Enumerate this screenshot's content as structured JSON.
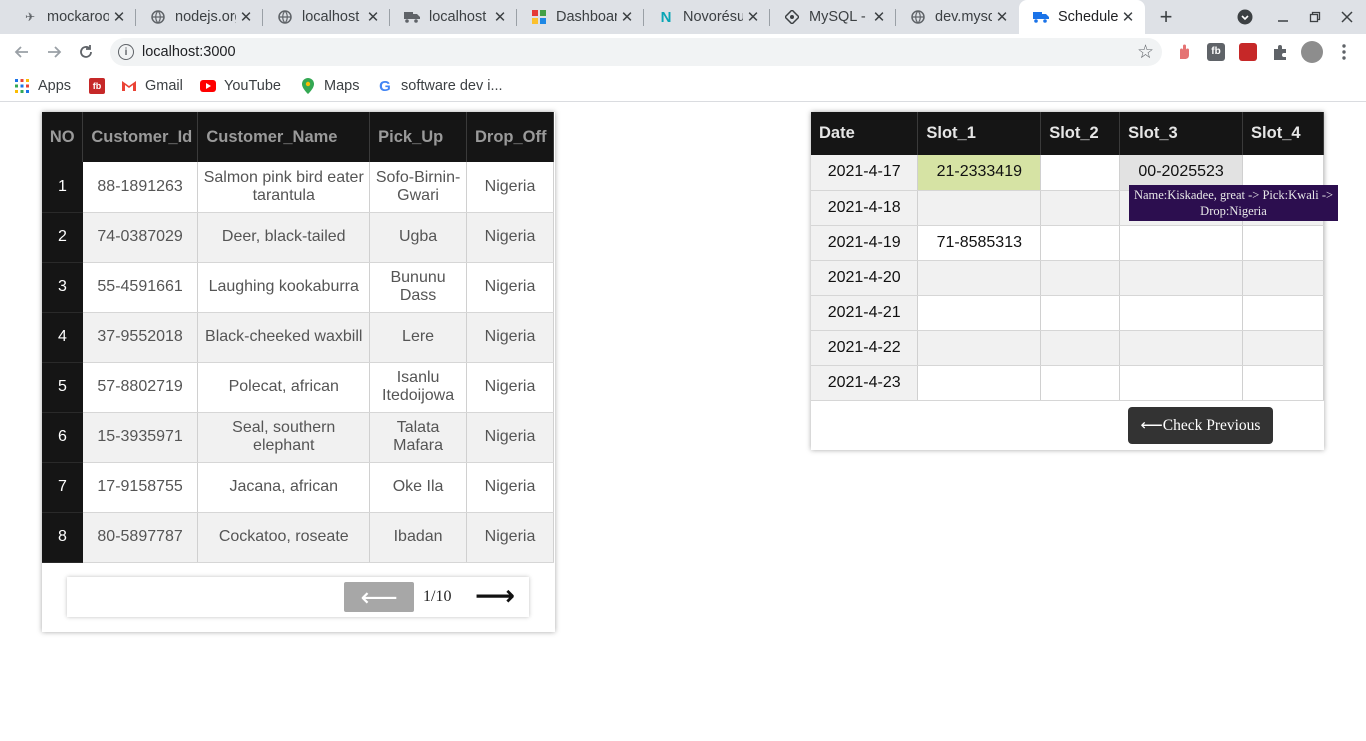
{
  "browser": {
    "tabs": [
      {
        "title": "mockaroo",
        "icon": "mockaroo-icon"
      },
      {
        "title": "nodejs.org",
        "icon": "globe-icon"
      },
      {
        "title": "localhost",
        "icon": "globe-icon"
      },
      {
        "title": "localhost",
        "icon": "truck-icon"
      },
      {
        "title": "Dashboard",
        "icon": "dashboard-icon"
      },
      {
        "title": "Novorésume",
        "icon": "novoresume-icon"
      },
      {
        "title": "MySQL - A",
        "icon": "mysql-icon"
      },
      {
        "title": "dev.mysql",
        "icon": "globe-icon"
      },
      {
        "title": "Schedule",
        "icon": "truck-icon"
      }
    ],
    "new_tab_label": "+",
    "url": "localhost:3000",
    "bookmarks": [
      {
        "label": "Apps",
        "icon": "apps-grid-icon"
      },
      {
        "label": "",
        "icon": "fb-icon"
      },
      {
        "label": "Gmail",
        "icon": "gmail-icon"
      },
      {
        "label": "YouTube",
        "icon": "youtube-icon"
      },
      {
        "label": "Maps",
        "icon": "maps-icon"
      },
      {
        "label": "software dev i...",
        "icon": "google-icon"
      }
    ],
    "accent": "#1a73e8"
  },
  "customers": {
    "columns": [
      "NO",
      "Customer_Id",
      "Customer_Name",
      "Pick_Up",
      "Drop_Off"
    ],
    "rows": [
      [
        "1",
        "88-1891263",
        "Salmon pink bird eater tarantula",
        "Sofo-Birnin-Gwari",
        "Nigeria"
      ],
      [
        "2",
        "74-0387029",
        "Deer, black-tailed",
        "Ugba",
        "Nigeria"
      ],
      [
        "3",
        "55-4591661",
        "Laughing kookaburra",
        "Bununu Dass",
        "Nigeria"
      ],
      [
        "4",
        "37-9552018",
        "Black-cheeked waxbill",
        "Lere",
        "Nigeria"
      ],
      [
        "5",
        "57-8802719",
        "Polecat, african",
        "Isanlu Itedoijowa",
        "Nigeria"
      ],
      [
        "6",
        "15-3935971",
        "Seal, southern elephant",
        "Talata Mafara",
        "Nigeria"
      ],
      [
        "7",
        "17-9158755",
        "Jacana, african",
        "Oke Ila",
        "Nigeria"
      ],
      [
        "8",
        "80-5897787",
        "Cockatoo, roseate",
        "Ibadan",
        "Nigeria"
      ]
    ],
    "pagination": {
      "prev": "⟵",
      "page": "1/10",
      "next": "⟶"
    }
  },
  "schedule": {
    "columns": [
      "Date",
      "Slot_1",
      "Slot_2",
      "Slot_3",
      "Slot_4"
    ],
    "rows": [
      [
        "2021-4-17",
        "21-2333419",
        "",
        "00-2025523",
        ""
      ],
      [
        "2021-4-18",
        "",
        "",
        "",
        ""
      ],
      [
        "2021-4-19",
        "71-8585313",
        "",
        "",
        ""
      ],
      [
        "2021-4-20",
        "",
        "",
        "",
        ""
      ],
      [
        "2021-4-21",
        "",
        "",
        "",
        ""
      ],
      [
        "2021-4-22",
        "",
        "",
        "",
        ""
      ],
      [
        "2021-4-23",
        "",
        "",
        "",
        ""
      ]
    ],
    "tooltip": "Name:Kiskadee, great -> Pick:Kwali -> Drop:Nigeria",
    "check_previous": "⟵Check Previous",
    "colors": {
      "booked_green": "#d6e3a4",
      "booked_grey": "#e2e2e2",
      "tooltip_bg": "#2c0e4f"
    }
  }
}
